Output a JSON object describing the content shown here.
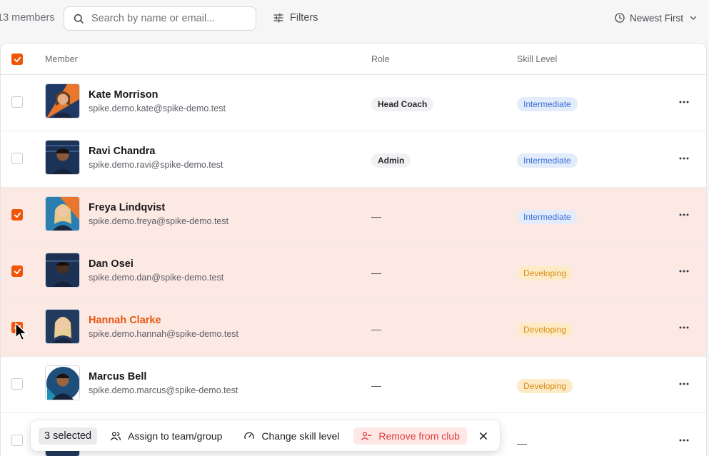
{
  "toolbar": {
    "member_count": "13 members",
    "search_placeholder": "Search by name or email...",
    "filters_label": "Filters",
    "sort_label": "Newest First"
  },
  "table": {
    "columns": {
      "member": "Member",
      "role": "Role",
      "skill": "Skill Level"
    },
    "rows": [
      {
        "name": "Kate Morrison",
        "email": "spike.demo.kate@spike-demo.test",
        "role": "Head Coach",
        "skill": "Intermediate",
        "selected": false
      },
      {
        "name": "Ravi Chandra",
        "email": "spike.demo.ravi@spike-demo.test",
        "role": "Admin",
        "skill": "Intermediate",
        "selected": false
      },
      {
        "name": "Freya Lindqvist",
        "email": "spike.demo.freya@spike-demo.test",
        "role": "—",
        "skill": "Intermediate",
        "selected": true
      },
      {
        "name": "Dan Osei",
        "email": "spike.demo.dan@spike-demo.test",
        "role": "—",
        "skill": "Developing",
        "selected": true
      },
      {
        "name": "Hannah Clarke",
        "email": "spike.demo.hannah@spike-demo.test",
        "role": "—",
        "skill": "Developing",
        "selected": true
      },
      {
        "name": "Marcus Bell",
        "email": "spike.demo.marcus@spike-demo.test",
        "role": "—",
        "skill": "Developing",
        "selected": false
      },
      {
        "name": "",
        "email": "",
        "role": "—",
        "skill": "",
        "selected": false
      }
    ]
  },
  "bulk_bar": {
    "selected_count": "3 selected",
    "assign_label": "Assign to team/group",
    "change_skill_label": "Change skill level",
    "remove_label": "Remove from club"
  },
  "colors": {
    "accent": "#f0550a",
    "selected_row": "#fde9e4",
    "intermediate_bg": "#e3ecfb",
    "intermediate_text": "#3d6fd6",
    "developing_bg": "#fdebc8",
    "developing_text": "#d98b15",
    "danger": "#e23b3b"
  },
  "icons": {
    "search": "search-icon",
    "filters": "sliders-icon",
    "sort": "clock-icon",
    "more": "more-horizontal-icon",
    "assign": "users-icon",
    "skill": "gauge-icon",
    "remove": "user-minus-icon",
    "close": "close-icon"
  }
}
